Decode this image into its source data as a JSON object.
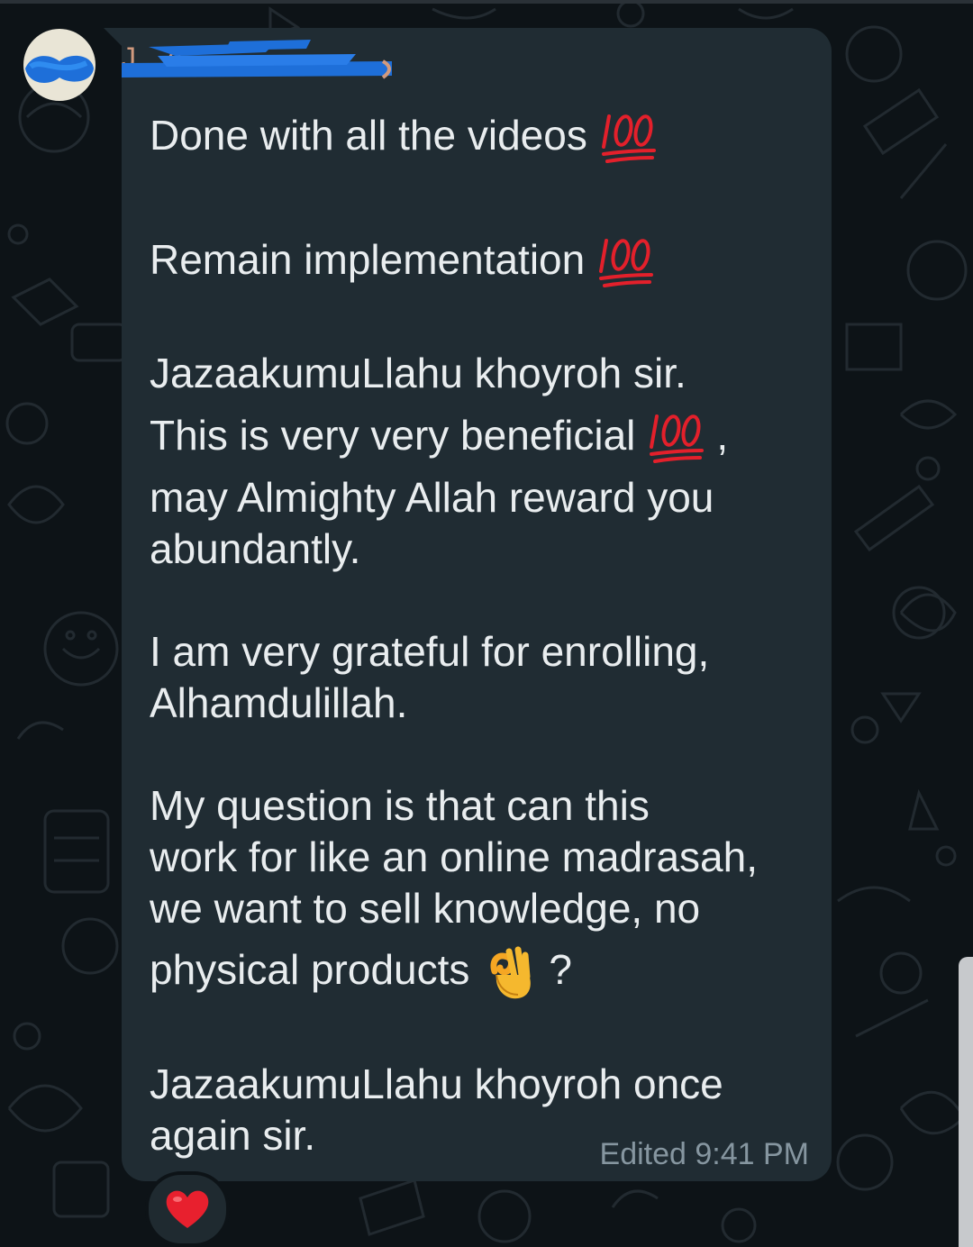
{
  "sender": {
    "name": "J...c",
    "name_redacted": true
  },
  "message": {
    "lines": [
      "Done with all the videos",
      "Remain implementation",
      "JazaakumuLlahu khoyroh sir.",
      "This is very very beneficial",
      ",",
      "may Almighty Allah reward you",
      "abundantly.",
      "I am very grateful for enrolling,",
      "Alhamdulillah.",
      "My question is that can this",
      "work for like an online madrasah,",
      "we want to sell knowledge,  no",
      "physical products",
      "?",
      "JazaakumuLlahu khoyroh once",
      "again sir."
    ],
    "emojis": {
      "hundred": "hundred-points-emoji",
      "ok_hand": "ok-hand-emoji"
    },
    "edited_label": "Edited",
    "time": "9:41 PM"
  },
  "reaction": {
    "emoji": "red-heart-emoji"
  },
  "colors": {
    "bubble": "#202c33",
    "text": "#e9edef",
    "meta": "#8696a0",
    "wallpaper": "#0d1317"
  }
}
